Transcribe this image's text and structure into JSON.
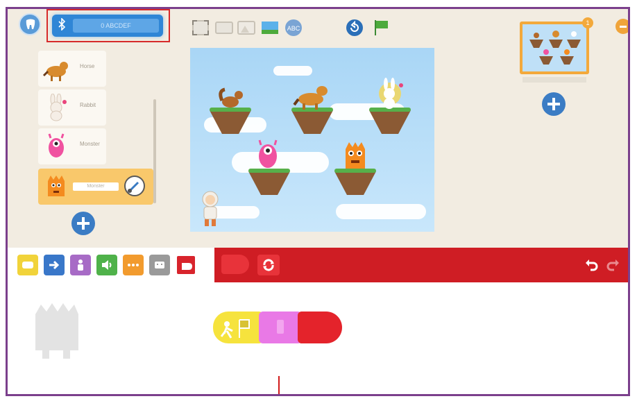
{
  "bluetooth": {
    "field_text": "0 ABCDEF"
  },
  "sprites": [
    {
      "name": "Horse",
      "icon": "horse-icon"
    },
    {
      "name": "Rabbit",
      "icon": "rabbit-icon"
    },
    {
      "name": "Monster",
      "icon": "pink-monster-icon"
    },
    {
      "name": "Monster",
      "icon": "orange-monster-icon",
      "selected": true
    }
  ],
  "page_thumb": {
    "badge": "1"
  },
  "palette": {
    "categories": [
      {
        "name": "triggers",
        "color": "#f1d33a",
        "icon": "trigger-icon"
      },
      {
        "name": "motion",
        "color": "#3977c9",
        "icon": "arrow-right-icon"
      },
      {
        "name": "looks",
        "color": "#a76bc6",
        "icon": "person-icon"
      },
      {
        "name": "sound",
        "color": "#4fb24a",
        "icon": "speaker-icon"
      },
      {
        "name": "control",
        "color": "#f29b2e",
        "icon": "dots-icon"
      },
      {
        "name": "robot",
        "color": "#9a9a9a",
        "icon": "robot-icon"
      },
      {
        "name": "end",
        "color": "#d8242c",
        "icon": "end-icon"
      }
    ]
  },
  "colors": {
    "frame_border": "#7b3f8c",
    "highlight_box": "#d72a2a",
    "palette_red": "#cf1d24",
    "stage_sky": "#a9d6f6"
  }
}
